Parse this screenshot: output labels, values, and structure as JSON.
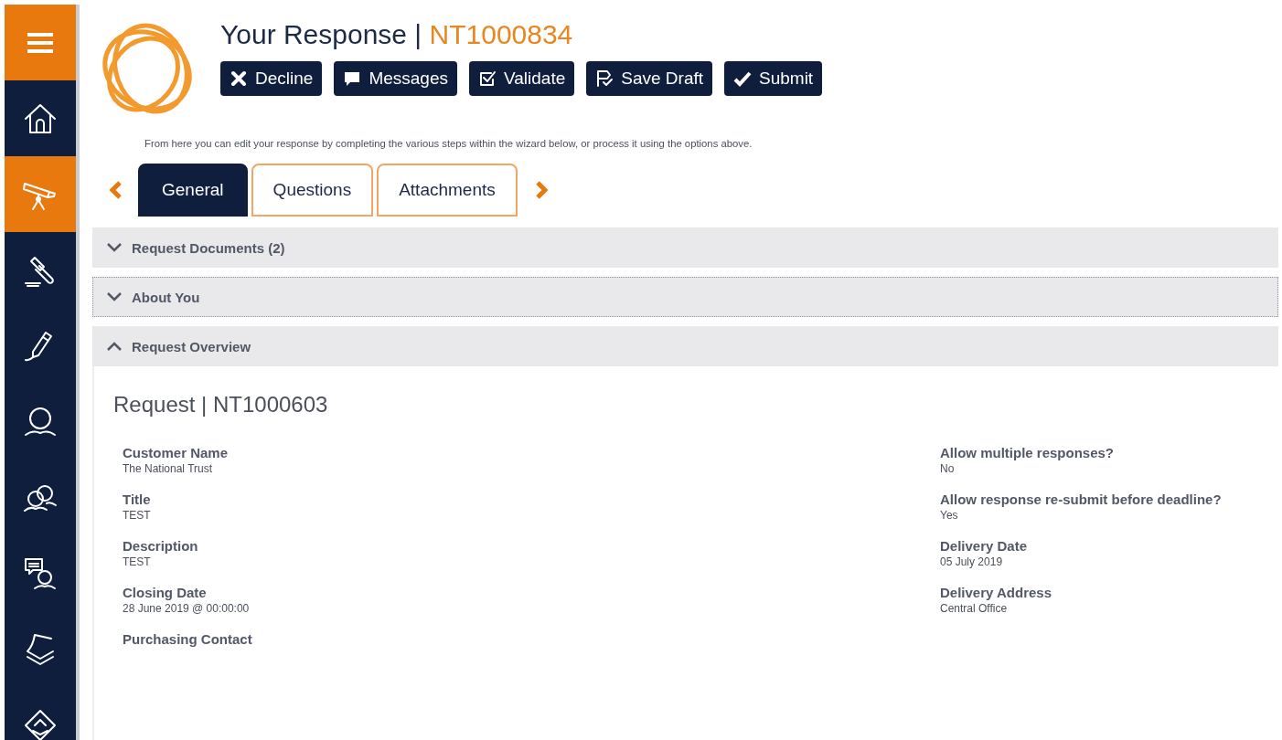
{
  "sidebar": {
    "items": [
      {
        "kind": "menu"
      },
      {
        "kind": "nav",
        "selected": false
      },
      {
        "kind": "nav",
        "selected": true
      },
      {
        "kind": "nav",
        "selected": false
      },
      {
        "kind": "nav",
        "selected": false
      },
      {
        "kind": "nav",
        "selected": false
      },
      {
        "kind": "nav",
        "selected": false
      },
      {
        "kind": "nav",
        "selected": false
      },
      {
        "kind": "nav",
        "selected": false
      },
      {
        "kind": "nav",
        "selected": false
      }
    ]
  },
  "header": {
    "title": "Your Response | ",
    "reference": "NT1000834",
    "buttons": [
      "Decline",
      "Messages",
      "Validate",
      "Save Draft",
      "Submit"
    ],
    "intro": "From here you can edit your response by completing the various steps within the wizard below, or process it using the options above."
  },
  "tabs": [
    {
      "label": "General",
      "selected": true
    },
    {
      "label": "Questions",
      "selected": false
    },
    {
      "label": "Attachments",
      "selected": false
    }
  ],
  "sections": [
    {
      "title": "Request Documents (2)",
      "expanded": false,
      "focused": false
    },
    {
      "title": "About You",
      "expanded": false,
      "focused": true
    },
    {
      "title": "Request Overview",
      "expanded": true,
      "focused": false
    }
  ],
  "overview": {
    "heading": "Request | NT1000603",
    "left_fields": [
      {
        "label": "Customer Name",
        "value": "The National Trust"
      },
      {
        "label": "Title",
        "value": "TEST"
      },
      {
        "label": "Description",
        "value": "TEST"
      },
      {
        "label": "Closing Date",
        "value": "28 June 2019 @ 00:00:00"
      },
      {
        "label": "Purchasing Contact"
      }
    ],
    "right_fields": [
      {
        "label": "Allow multiple responses?",
        "value": "No"
      },
      {
        "label": "Allow response re-submit before deadline?",
        "value": "Yes"
      },
      {
        "label": "Delivery Date",
        "value": "05 July 2019"
      },
      {
        "label": "Delivery Address",
        "value": "Central Office"
      }
    ]
  }
}
